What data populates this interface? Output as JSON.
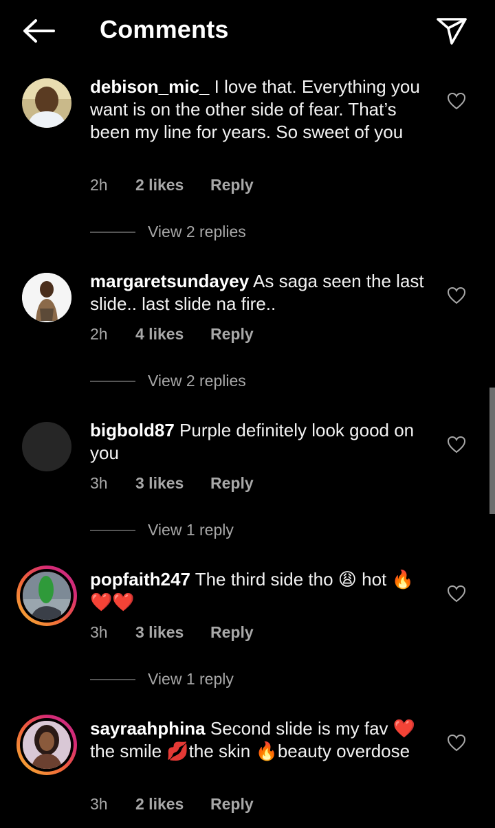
{
  "header": {
    "title": "Comments",
    "back_icon": "arrow-left-icon",
    "share_icon": "paper-plane-icon"
  },
  "comments": [
    {
      "username": "debison_mic_",
      "text": "I love that. Everything you want is on the other side of fear. That’s been my line for years. So sweet of you",
      "time": "2h",
      "likes": "2 likes",
      "reply": "Reply",
      "view_replies": "View 2 replies"
    },
    {
      "username": "margaretsundayey",
      "text": "As saga seen the last slide.. last slide na fire..",
      "time": "2h",
      "likes": "4 likes",
      "reply": "Reply",
      "view_replies": "View 2 replies"
    },
    {
      "username": "bigbold87",
      "text": "Purple definitely look good on you",
      "time": "3h",
      "likes": "3 likes",
      "reply": "Reply",
      "view_replies": "View 1 reply"
    },
    {
      "username": "popfaith247",
      "text": "The third side tho 😩 hot 🔥❤️❤️",
      "time": "3h",
      "likes": "3 likes",
      "reply": "Reply",
      "view_replies": "View 1 reply"
    },
    {
      "username": "sayraahphina",
      "text": "Second slide is my fav ❤️the smile 💋the skin 🔥beauty overdose",
      "time": "3h",
      "likes": "2 likes",
      "reply": "Reply"
    }
  ],
  "colors": {
    "background": "#000000",
    "text": "#f2f2f2",
    "secondary_text": "#a8a8a8",
    "story_ring_start": "#f7b733",
    "story_ring_end": "#c13584"
  }
}
